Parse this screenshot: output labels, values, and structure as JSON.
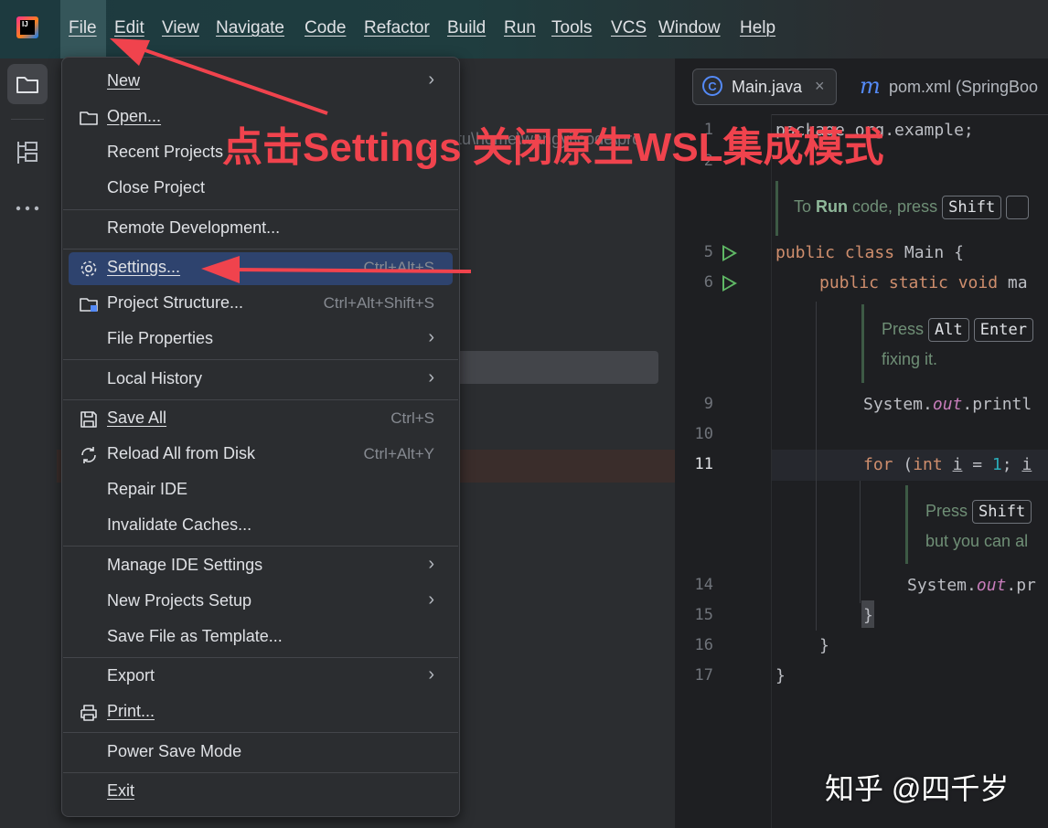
{
  "menubar": {
    "logo_text": "IJ",
    "items": [
      "File",
      "Edit",
      "View",
      "Navigate",
      "Code",
      "Refactor",
      "Build",
      "Run",
      "Tools",
      "VCS",
      "Window",
      "Help"
    ]
  },
  "project_panel": {
    "path_text": "ntu\\home\\wangyi\\code\\pro"
  },
  "editor": {
    "tabs": [
      {
        "label": "Main.java",
        "icon": "java-class-icon",
        "close": "×"
      },
      {
        "label": "pom.xml (SpringBoo",
        "icon": "maven-icon"
      }
    ],
    "lines": [
      {
        "num": "1",
        "text": "package org.example;"
      },
      {
        "num": "2",
        "text": ""
      },
      {
        "num": "5",
        "text": "public class Main {"
      },
      {
        "num": "6",
        "text": "public static void ma"
      },
      {
        "num": "9",
        "text": "System.out.printl"
      },
      {
        "num": "10",
        "text": ""
      },
      {
        "num": "11",
        "text": "for (int i = 1; i"
      },
      {
        "num": "14",
        "text": "System.out.pr"
      },
      {
        "num": "15",
        "text": "}"
      },
      {
        "num": "16",
        "text": "}"
      },
      {
        "num": "17",
        "text": "}"
      }
    ],
    "hints": {
      "run": {
        "prefix": "To ",
        "bold": "Run",
        "suffix": " code, press",
        "key": "Shift"
      },
      "alt": {
        "prefix": "Press",
        "key1": "Alt",
        "key2": "Enter",
        "line2": "fixing it."
      },
      "shift": {
        "prefix": "Press",
        "key": "Shift",
        "line2": "but you can al"
      }
    }
  },
  "file_menu": {
    "items": [
      {
        "label": "New",
        "shortcut": "",
        "submenu": true,
        "icon": ""
      },
      {
        "label": "Open...",
        "shortcut": "",
        "submenu": false,
        "icon": "folder-icon"
      },
      {
        "label": "Recent Projects",
        "shortcut": "",
        "submenu": true,
        "icon": ""
      },
      {
        "label": "Close Project",
        "shortcut": "",
        "submenu": false,
        "icon": ""
      },
      {
        "label": "Remote Development...",
        "shortcut": "",
        "submenu": false,
        "icon": ""
      },
      {
        "label": "Settings...",
        "shortcut": "Ctrl+Alt+S",
        "submenu": false,
        "icon": "gear-icon"
      },
      {
        "label": "Project Structure...",
        "shortcut": "Ctrl+Alt+Shift+S",
        "submenu": false,
        "icon": "project-structure-icon"
      },
      {
        "label": "File Properties",
        "shortcut": "",
        "submenu": true,
        "icon": ""
      },
      {
        "label": "Local History",
        "shortcut": "",
        "submenu": true,
        "icon": ""
      },
      {
        "label": "Save All",
        "shortcut": "Ctrl+S",
        "submenu": false,
        "icon": "save-icon"
      },
      {
        "label": "Reload All from Disk",
        "shortcut": "Ctrl+Alt+Y",
        "submenu": false,
        "icon": "reload-icon"
      },
      {
        "label": "Repair IDE",
        "shortcut": "",
        "submenu": false,
        "icon": ""
      },
      {
        "label": "Invalidate Caches...",
        "shortcut": "",
        "submenu": false,
        "icon": ""
      },
      {
        "label": "Manage IDE Settings",
        "shortcut": "",
        "submenu": true,
        "icon": ""
      },
      {
        "label": "New Projects Setup",
        "shortcut": "",
        "submenu": true,
        "icon": ""
      },
      {
        "label": "Save File as Template...",
        "shortcut": "",
        "submenu": false,
        "icon": ""
      },
      {
        "label": "Export",
        "shortcut": "",
        "submenu": true,
        "icon": ""
      },
      {
        "label": "Print...",
        "shortcut": "",
        "submenu": false,
        "icon": "print-icon"
      },
      {
        "label": "Power Save Mode",
        "shortcut": "",
        "submenu": false,
        "icon": ""
      },
      {
        "label": "Exit",
        "shortcut": "",
        "submenu": false,
        "icon": ""
      }
    ],
    "submenu_glyph": "›"
  },
  "annotation": {
    "text": "点击Settings 关闭原生WSL集成模式",
    "color": "#f0434d"
  },
  "watermark": "知乎 @四千岁"
}
